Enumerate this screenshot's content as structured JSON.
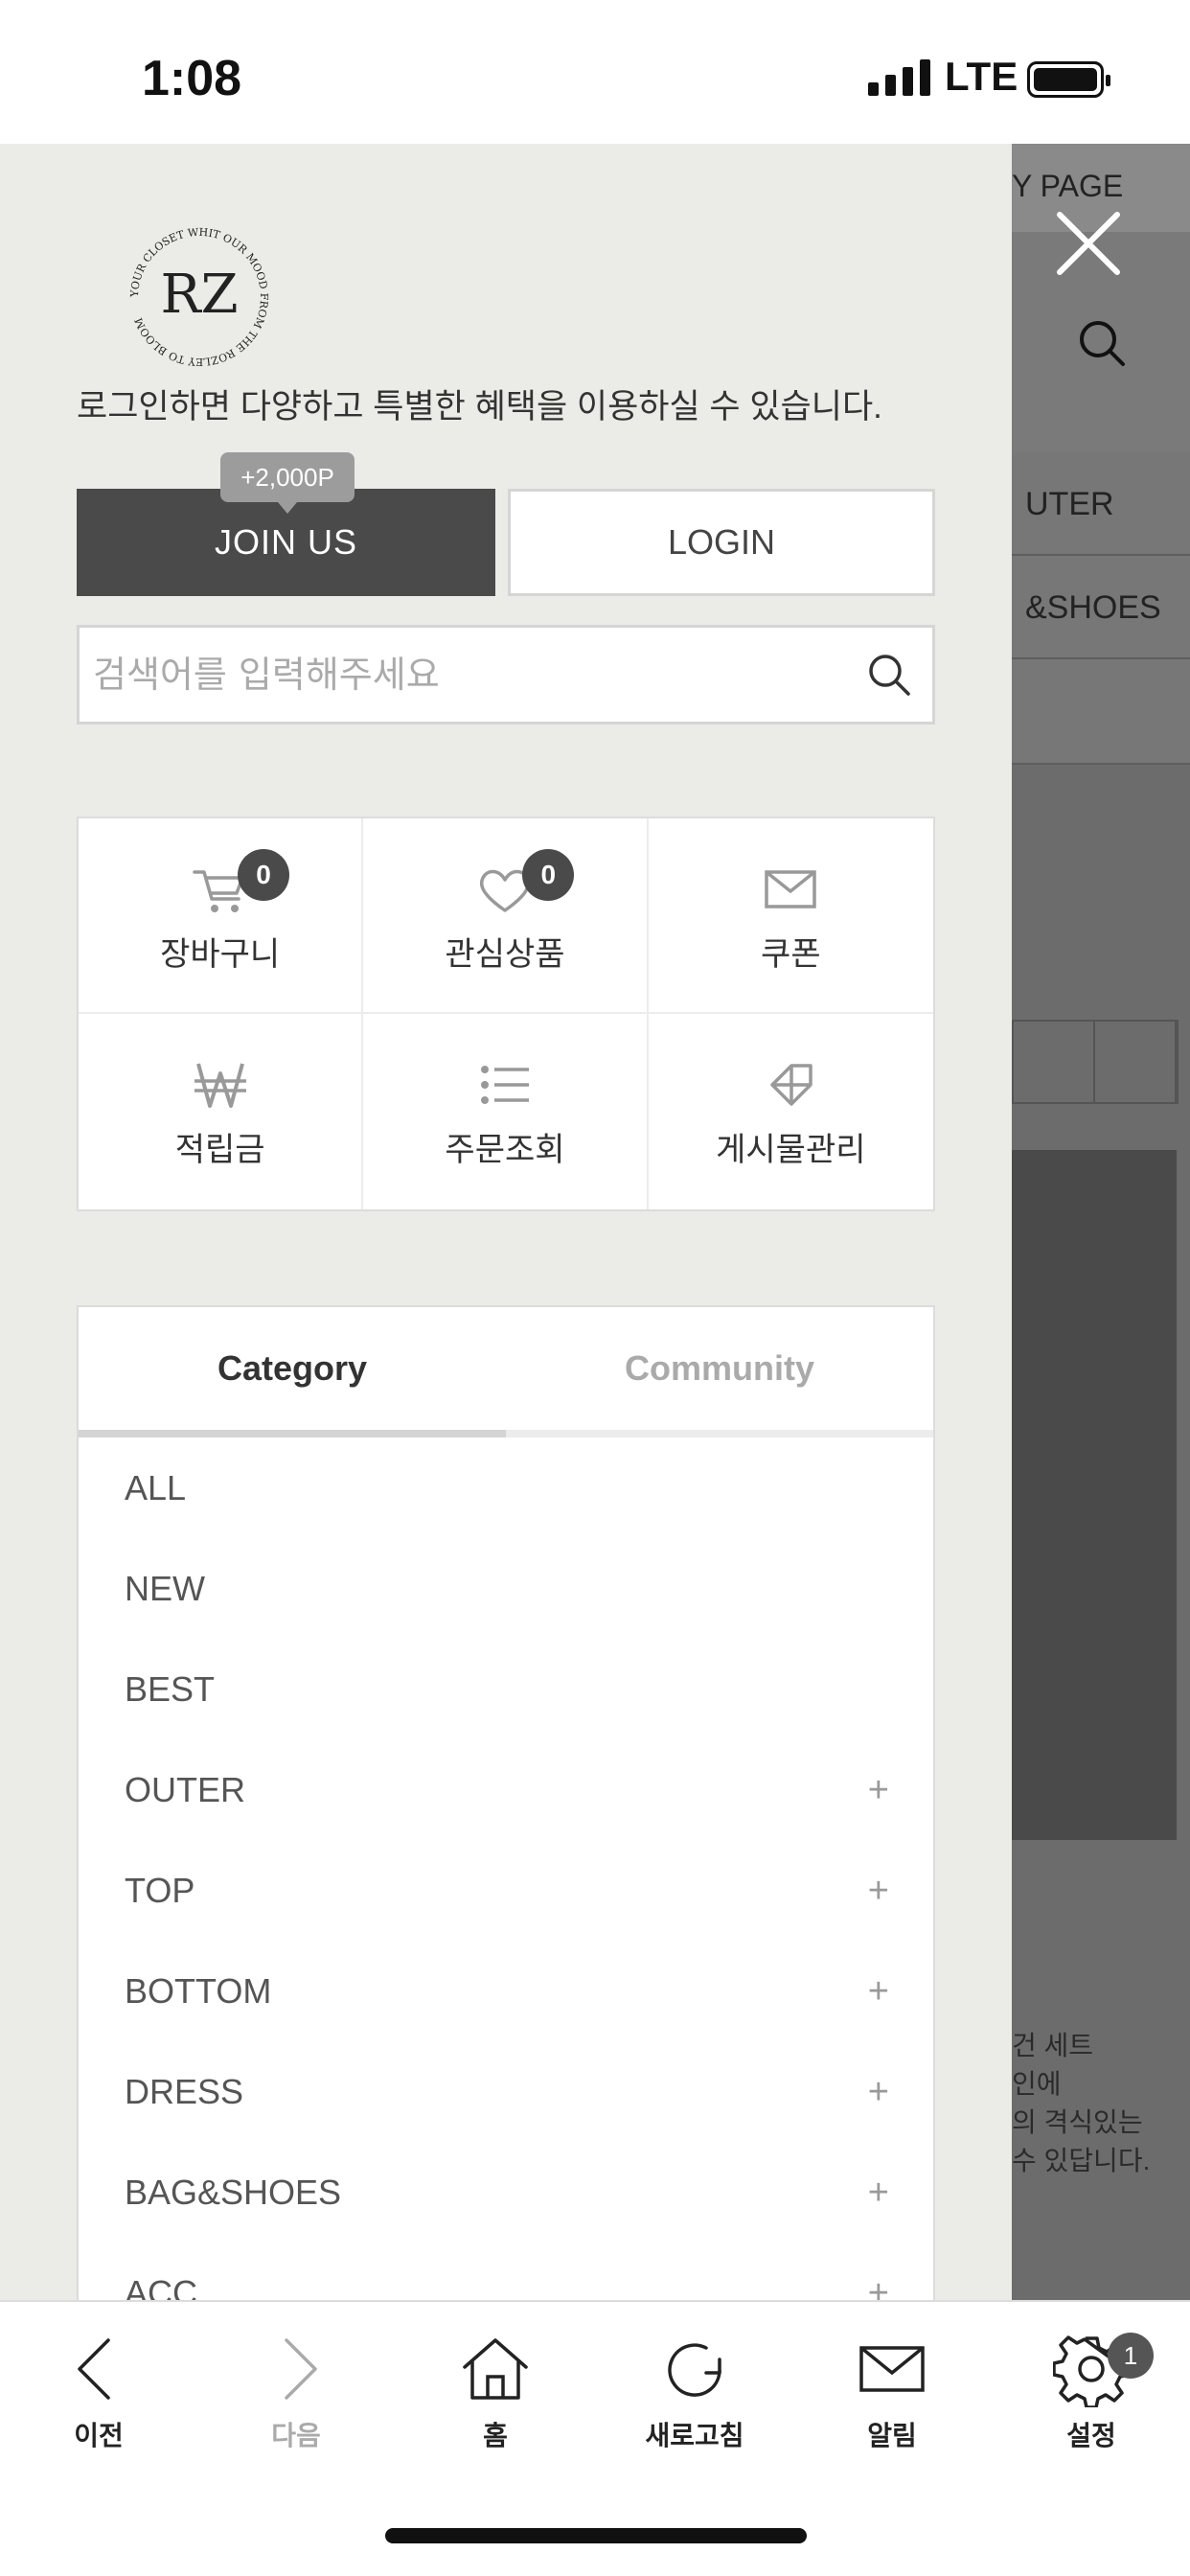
{
  "status": {
    "time": "1:08",
    "network": "LTE"
  },
  "background": {
    "page_label": "Y PAGE",
    "rows": [
      "UTER",
      "&SHOES"
    ],
    "snippet": [
      "건 세트",
      "인에",
      "의 격식있는",
      "수 있답니다."
    ]
  },
  "drawer": {
    "logo_initials": "RZ",
    "logo_ring_text": "YOUR CLOSET WHIT OUR MOOD FROM THE ROZLEY TO BLOOM",
    "notice": "로그인하면 다양하고 특별한 혜택을 이용하실 수 있습니다.",
    "join_label": "JOIN US",
    "join_bonus": "+2,000P",
    "login_label": "LOGIN",
    "search_placeholder": "검색어를 입력해주세요",
    "shortcuts": [
      {
        "label": "장바구니",
        "icon": "cart-icon",
        "badge": "0"
      },
      {
        "label": "관심상품",
        "icon": "heart-icon",
        "badge": "0"
      },
      {
        "label": "쿠폰",
        "icon": "envelope-icon"
      },
      {
        "label": "적립금",
        "icon": "won-icon"
      },
      {
        "label": "주문조회",
        "icon": "list-icon"
      },
      {
        "label": "게시물관리",
        "icon": "tag-icon"
      }
    ],
    "tabs": [
      {
        "label": "Category",
        "active": true
      },
      {
        "label": "Community",
        "active": false
      }
    ],
    "categories": [
      {
        "label": "ALL",
        "expandable": false
      },
      {
        "label": "NEW",
        "expandable": false
      },
      {
        "label": "BEST",
        "expandable": false
      },
      {
        "label": "OUTER",
        "expandable": true
      },
      {
        "label": "TOP",
        "expandable": true
      },
      {
        "label": "BOTTOM",
        "expandable": true
      },
      {
        "label": "DRESS",
        "expandable": true
      },
      {
        "label": "BAG&SHOES",
        "expandable": true
      },
      {
        "label": "ACC",
        "expandable": true
      }
    ],
    "plus_symbol": "+"
  },
  "toolbar": {
    "items": [
      {
        "label": "이전",
        "icon": "back-icon"
      },
      {
        "label": "다음",
        "icon": "forward-icon"
      },
      {
        "label": "홈",
        "icon": "home-icon"
      },
      {
        "label": "새로고침",
        "icon": "refresh-icon"
      },
      {
        "label": "알림",
        "icon": "mail-icon"
      },
      {
        "label": "설정",
        "icon": "gear-icon"
      }
    ],
    "settings_badge": "1"
  }
}
